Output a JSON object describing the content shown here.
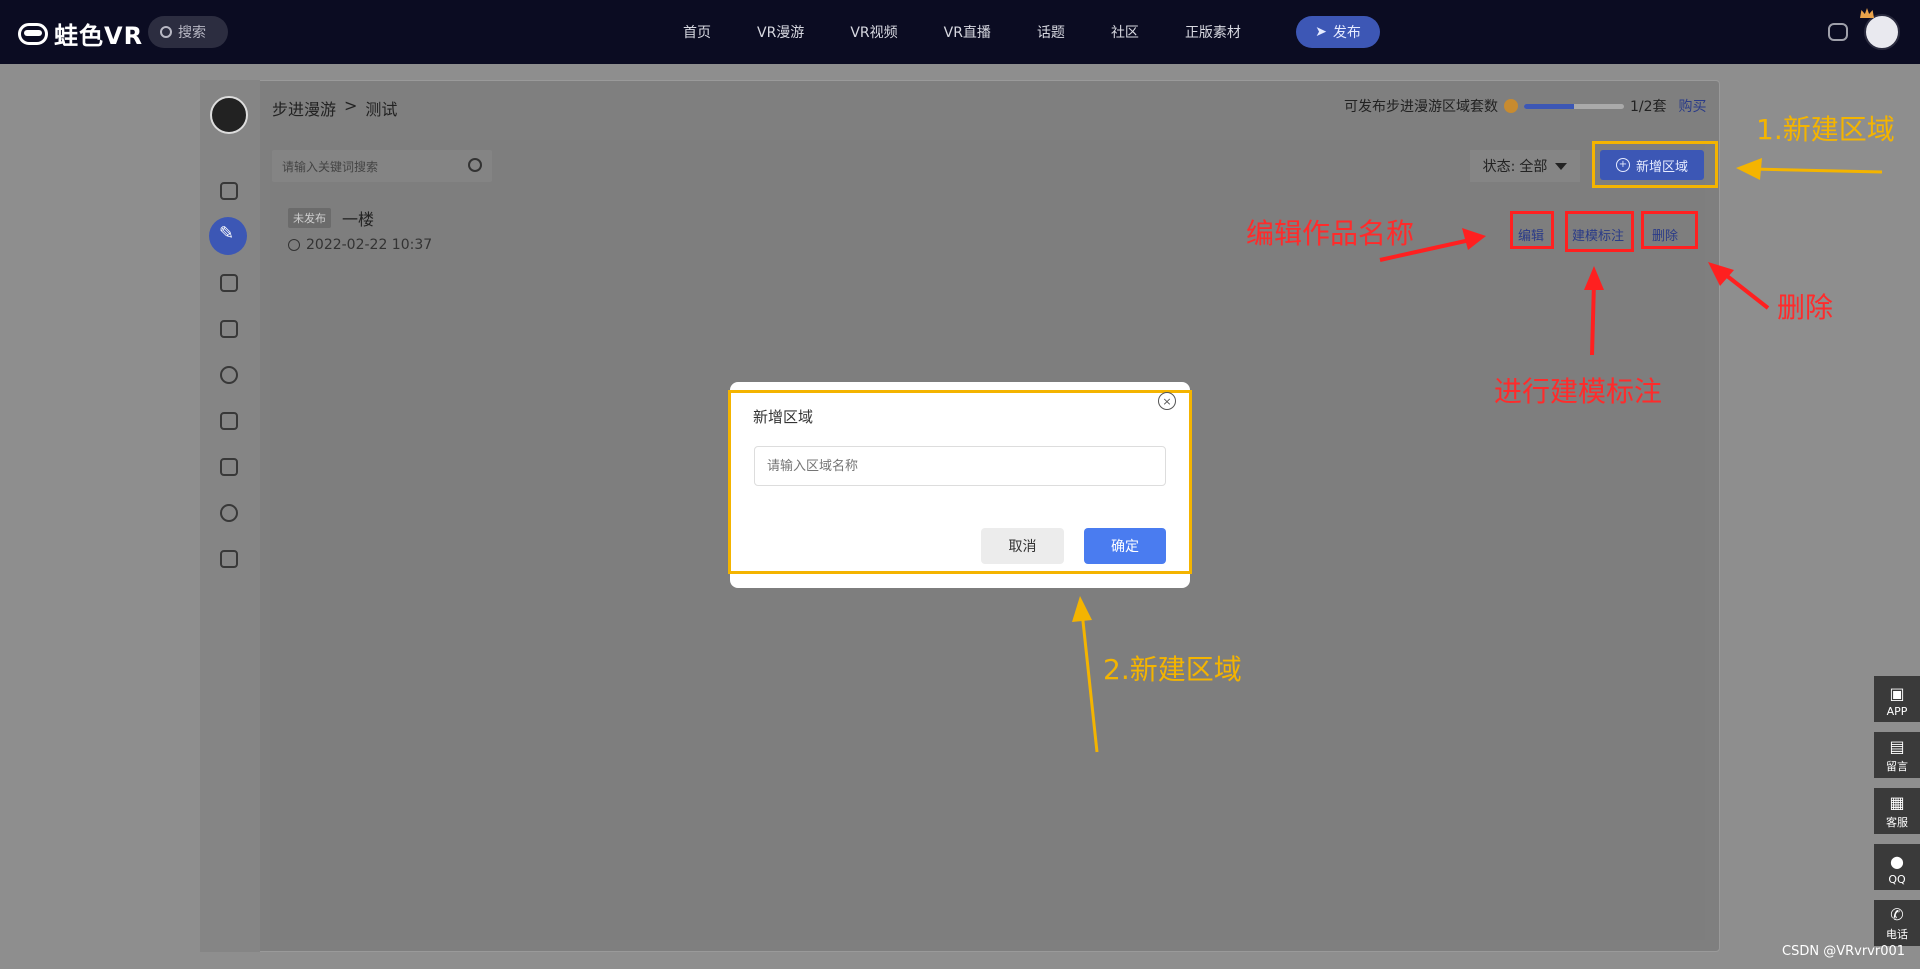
{
  "brand": {
    "logo_text": "蛙色VR"
  },
  "topbar": {
    "search_label": "搜索",
    "nav": [
      "首页",
      "VR漫游",
      "VR视频",
      "VR直播",
      "话题",
      "社区",
      "正版素材"
    ],
    "publish_label": "发布"
  },
  "breadcrumb": {
    "parent": "步进漫游",
    "sep": ">",
    "current": "测试"
  },
  "quota": {
    "label": "可发布步进漫游区域套数",
    "used": 1,
    "total": 2,
    "fraction": 0.5,
    "text": "1/2套",
    "buy": "购买"
  },
  "toolbar": {
    "search_placeholder": "请输入关键词搜索",
    "status_label": "状态:",
    "status_value": "全部",
    "add_area_label": "新增区域"
  },
  "list": {
    "items": [
      {
        "tag": "未发布",
        "title": "一楼",
        "time": "2022-02-22 10:37"
      }
    ],
    "ops": {
      "edit": "编辑",
      "annotate": "建模标注",
      "delete": "删除"
    }
  },
  "modal": {
    "title": "新增区域",
    "input_placeholder": "请输入区域名称",
    "cancel": "取消",
    "confirm": "确定"
  },
  "annotations": {
    "step1": "1.新建区域",
    "step2": "2.新建区域",
    "edit_name": "编辑作品名称",
    "annotate": "进行建模标注",
    "delete": "删除"
  },
  "floatbar": [
    "APP",
    "留言",
    "客服",
    "QQ",
    "电话"
  ],
  "watermark": "CSDN @VRvrvr001",
  "colors": {
    "accent": "#3c57b5",
    "annotation_red": "#ff2020",
    "annotation_yellow": "#f4b400",
    "confirm": "#4a7cf0"
  }
}
